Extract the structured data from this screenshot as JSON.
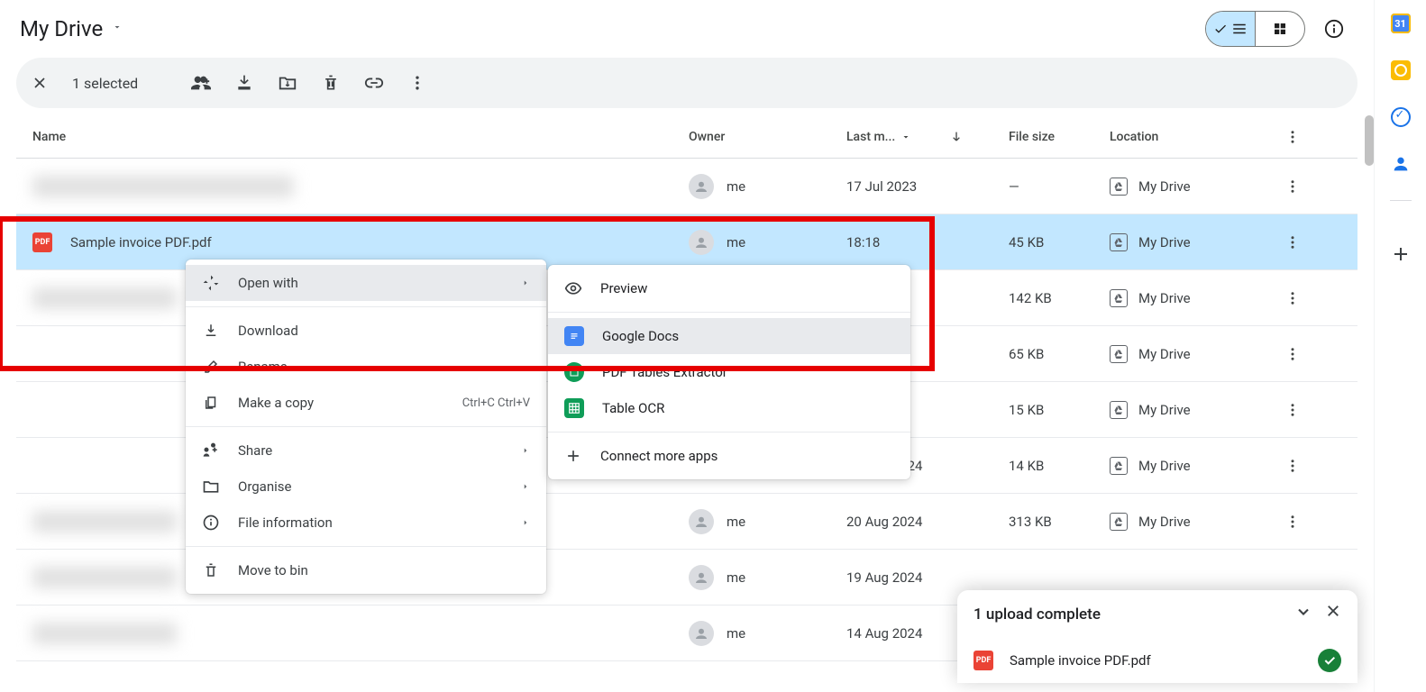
{
  "header": {
    "title": "My Drive",
    "info_tooltip": "View details"
  },
  "view_toggle": {
    "list_active": true
  },
  "selection_toolbar": {
    "count_label": "1 selected"
  },
  "columns": {
    "name": "Name",
    "owner": "Owner",
    "last_modified": "Last m...",
    "file_size": "File size",
    "location": "Location"
  },
  "sidepanel": {
    "calendar_day": "31"
  },
  "rows": [
    {
      "name_blur_w": 290,
      "owner": "me",
      "modified": "17 Jul 2023",
      "size": "—",
      "location": "My Drive"
    },
    {
      "selected": true,
      "pdf": true,
      "name": "Sample invoice PDF.pdf",
      "owner": "me",
      "modified": "18:18",
      "size": "45 KB",
      "location": "My Drive"
    },
    {
      "name_blur_w": 160,
      "owner_hidden": true,
      "modified_hidden": true,
      "size": "142 KB",
      "location": "My Drive"
    },
    {
      "name_blur_w": 0,
      "owner_hidden": true,
      "modified_hidden": true,
      "size": "65 KB",
      "location": "My Drive"
    },
    {
      "name_blur_w": 0,
      "owner_hidden": true,
      "modified_hidden": true,
      "size": "15 KB",
      "location": "My Drive"
    },
    {
      "name_blur_w": 0,
      "owner_hidden": true,
      "modified_tail": "024",
      "size": "14 KB",
      "location": "My Drive"
    },
    {
      "name_blur_w": 160,
      "owner": "me",
      "modified": "20 Aug 2024",
      "size": "313 KB",
      "location": "My Drive"
    },
    {
      "name_blur_w": 160,
      "owner": "me",
      "modified": "19 Aug 2024",
      "size_hidden": true,
      "location_hidden": true
    },
    {
      "name_blur_w": 160,
      "owner": "me",
      "modified": "14 Aug 2024",
      "size_hidden": true,
      "location_hidden": true
    }
  ],
  "context_menu": {
    "open_with": "Open with",
    "download": "Download",
    "rename": "Rename",
    "make_copy": "Make a copy",
    "make_copy_shortcut": "Ctrl+C Ctrl+V",
    "share": "Share",
    "organise": "Organise",
    "file_info": "File information",
    "move_to_bin": "Move to bin"
  },
  "submenu": {
    "preview": "Preview",
    "google_docs": "Google Docs",
    "pdf_tables": "PDF Tables Extractor",
    "table_ocr": "Table OCR",
    "connect_more": "Connect more apps"
  },
  "toast": {
    "title": "1 upload complete",
    "file": "Sample invoice PDF.pdf"
  }
}
